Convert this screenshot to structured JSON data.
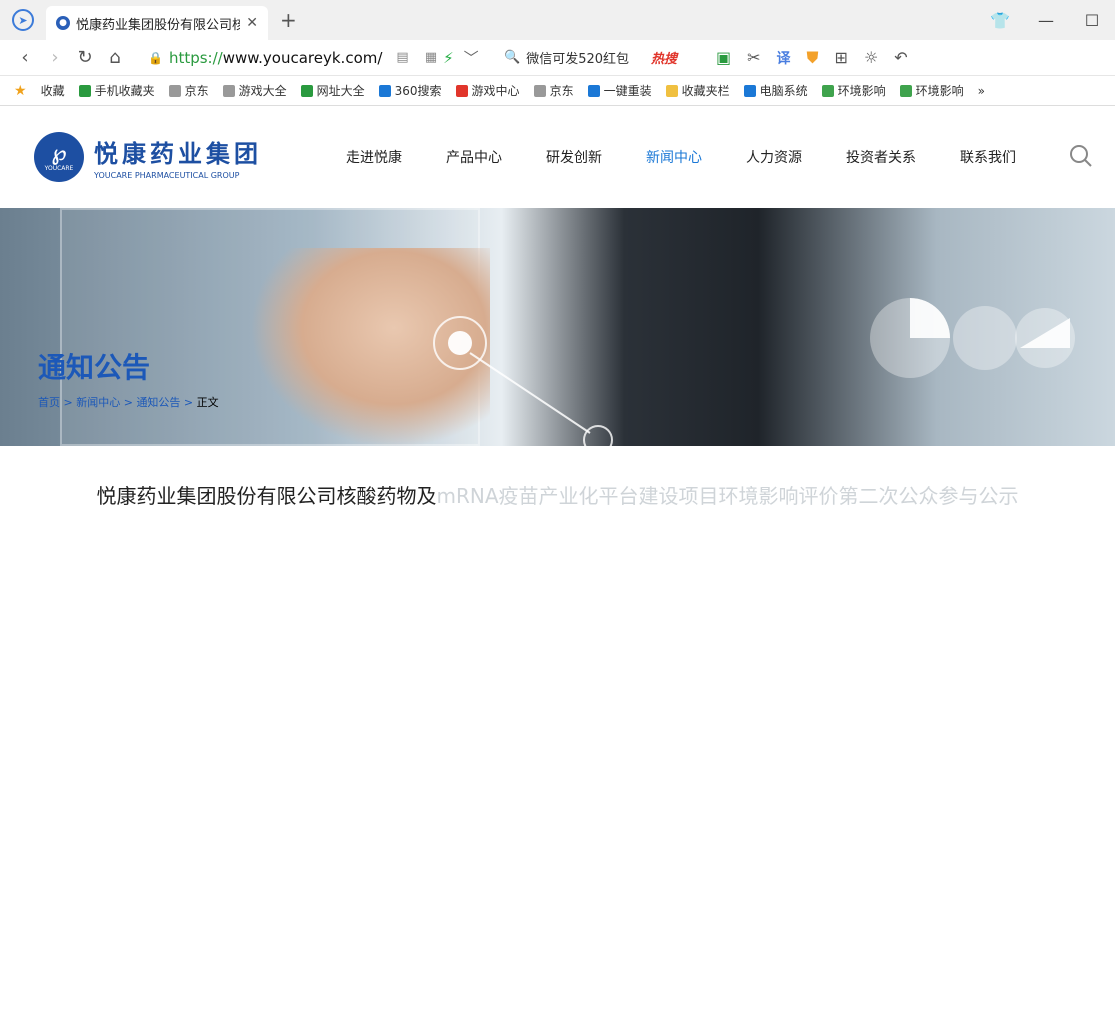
{
  "browser": {
    "tab_title": "悦康药业集团股份有限公司核酸",
    "url_https": "https://",
    "url_host": "www.youcareyk.com/",
    "search_hint": "微信可发520红包",
    "hot_label": "热搜"
  },
  "bookmarks": [
    {
      "label": "收藏",
      "color": "#f0a21c"
    },
    {
      "label": "手机收藏夹",
      "color": "#2a9a3f"
    },
    {
      "label": "京东",
      "color": "#999999"
    },
    {
      "label": "游戏大全",
      "color": "#999999"
    },
    {
      "label": "网址大全",
      "color": "#2a9a3f"
    },
    {
      "label": "360搜索",
      "color": "#1b78d6"
    },
    {
      "label": "游戏中心",
      "color": "#e1352b"
    },
    {
      "label": "京东",
      "color": "#999999"
    },
    {
      "label": "一键重装",
      "color": "#1b78d6"
    },
    {
      "label": "收藏夹栏",
      "color": "#f0c040"
    },
    {
      "label": "电脑系统",
      "color": "#1b78d6"
    },
    {
      "label": "环境影响",
      "color": "#3fa34d"
    },
    {
      "label": "环境影响",
      "color": "#3fa34d"
    }
  ],
  "site": {
    "logo_cn": "悦康药业集团",
    "logo_en": "YOUCARE PHARMACEUTICAL GROUP",
    "logo_mark_text": "YOUCARE",
    "nav": [
      "走进悦康",
      "产品中心",
      "研发创新",
      "新闻中心",
      "人力资源",
      "投资者关系",
      "联系我们"
    ],
    "active_nav": "新闻中心"
  },
  "banner": {
    "title": "通知公告",
    "crumbs": [
      "首页",
      "新闻中心",
      "通知公告"
    ],
    "crumb_current": "正文"
  },
  "article": {
    "title_visible": "悦康药业集团股份有限公司核酸药物及",
    "title_faded": "mRNA疫苗产业化平台建设项目环境影响评价第二次公众参与公示"
  }
}
